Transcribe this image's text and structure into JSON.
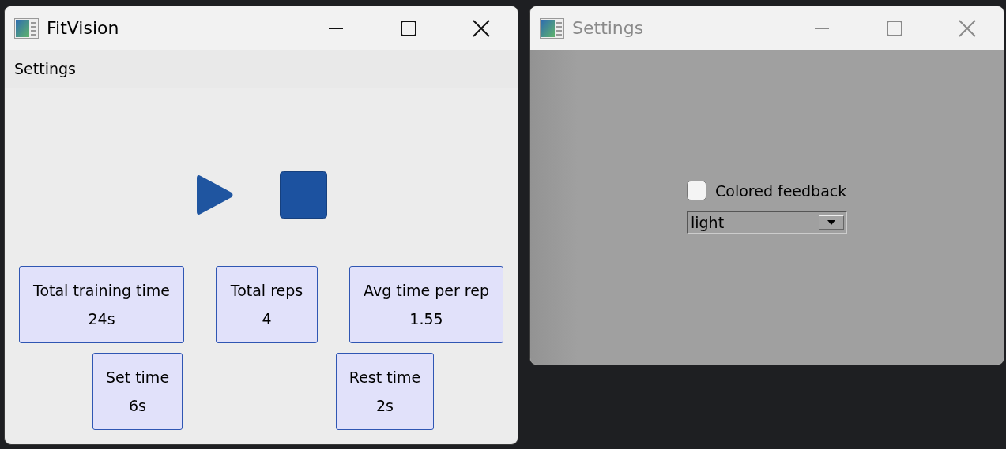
{
  "main_window": {
    "title": "FitVision",
    "active": true,
    "menu": [
      {
        "label": "Settings"
      }
    ],
    "stat_rows": [
      [
        {
          "label": "Total training time",
          "value": "24s"
        },
        {
          "label": "Total reps",
          "value": "4"
        },
        {
          "label": "Avg time per rep",
          "value": "1.55"
        }
      ],
      [
        {
          "label": "Set time",
          "value": "6s"
        },
        {
          "label": "Rest time",
          "value": "2s"
        }
      ]
    ]
  },
  "settings_window": {
    "title": "Settings",
    "active": false,
    "colored_feedback": {
      "label": "Colored feedback",
      "checked": false
    },
    "theme_select": {
      "value": "light"
    }
  }
}
